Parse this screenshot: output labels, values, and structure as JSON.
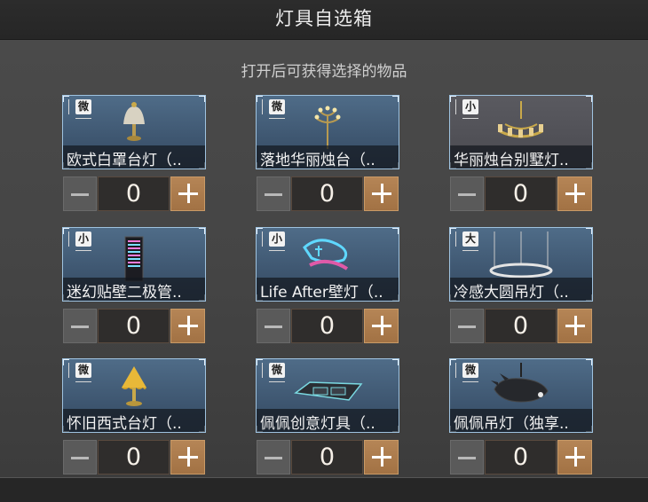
{
  "header": {
    "title": "灯具自选箱"
  },
  "subtitle": "打开后可获得选择的物品",
  "items": [
    {
      "name": "欧式白罩台灯（..",
      "size": "微",
      "quantity": "0",
      "icon": "table-lamp-icon"
    },
    {
      "name": "落地华丽烛台（..",
      "size": "微",
      "quantity": "0",
      "icon": "candelabra-icon"
    },
    {
      "name": "华丽烛台别墅灯..",
      "size": "小",
      "quantity": "0",
      "icon": "chandelier-icon"
    },
    {
      "name": "迷幻贴壁二极管..",
      "size": "小",
      "quantity": "0",
      "icon": "led-wall-light-icon"
    },
    {
      "name": "Life After壁灯（..",
      "size": "小",
      "quantity": "0",
      "icon": "neon-sign-icon"
    },
    {
      "name": "冷感大圆吊灯（..",
      "size": "大",
      "quantity": "0",
      "icon": "ring-pendant-lamp-icon"
    },
    {
      "name": "怀旧西式台灯（..",
      "size": "微",
      "quantity": "0",
      "icon": "vintage-table-lamp-icon"
    },
    {
      "name": "佩佩创意灯具（..",
      "size": "微",
      "quantity": "0",
      "icon": "creative-flat-lamp-icon"
    },
    {
      "name": "佩佩吊灯（独享..",
      "size": "微",
      "quantity": "0",
      "icon": "pig-pendant-lamp-icon"
    }
  ]
}
